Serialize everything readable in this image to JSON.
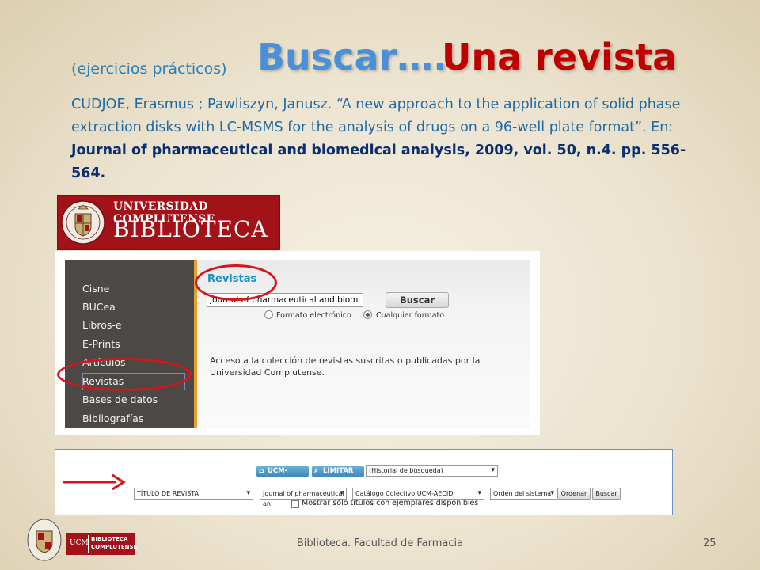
{
  "slide": {
    "subtitle": "(ejercicios prácticos)",
    "title_part1": "Buscar….",
    "title_part2": "Una revista",
    "citation_plain": "CUDJOE, Erasmus ; Pawliszyn, Janusz. “A new approach to the application of solid phase extraction disks with LC-MSMS for the analysis of drugs on a 96-well plate format”. En: ",
    "citation_journal": "Journal of pharmaceutical and biomedical analysis, 2009, vol. 50, n.4. pp. 556-564."
  },
  "ucm_banner": {
    "university": "UNIVERSIDAD COMPLUTENSE",
    "library": "BIBLIOTECA"
  },
  "library_panel": {
    "nav_items": [
      "Cisne",
      "BUCea",
      "Libros-e",
      "E-Prints",
      "Artículos",
      "Revistas",
      "Bases de datos",
      "Bibliografías"
    ],
    "section_title": "Revistas",
    "search_value": "Journal of pharmaceutical and biom",
    "search_button": "Buscar",
    "radio_options": [
      {
        "label": "Formato electrónico",
        "selected": false
      },
      {
        "label": "Cualquier formato",
        "selected": true
      }
    ],
    "description": "Acceso a la colección de revistas suscritas o publicadas por la Universidad Complutense."
  },
  "catalog_panel": {
    "btn_ucm": "UCM-AECID",
    "btn_limit": "LIMITAR",
    "history_select": "(Historial de búsqueda)",
    "field_select": "TÍTULO DE REVISTA",
    "query_value": "Journal of pharmaceutical an",
    "catalog_select": "Catálogo Colectivo UCM-AECID",
    "order_select": "Orden del sistema",
    "order_button": "Ordenar",
    "search_button": "Buscar",
    "checkbox_label": "Mostrar sólo títulos con ejemplares disponibles"
  },
  "footer": {
    "text": "Biblioteca. Facultad de Farmacia",
    "page_number": "25",
    "logo_ucm": "UCM",
    "logo_line1": "BIBLIOTECA",
    "logo_line2": "COMPLUTENSE"
  },
  "colors": {
    "title_blue": "#4a90d9",
    "title_red": "#c00000",
    "annotation_red": "#d7141a",
    "ucm_red": "#a31219"
  }
}
